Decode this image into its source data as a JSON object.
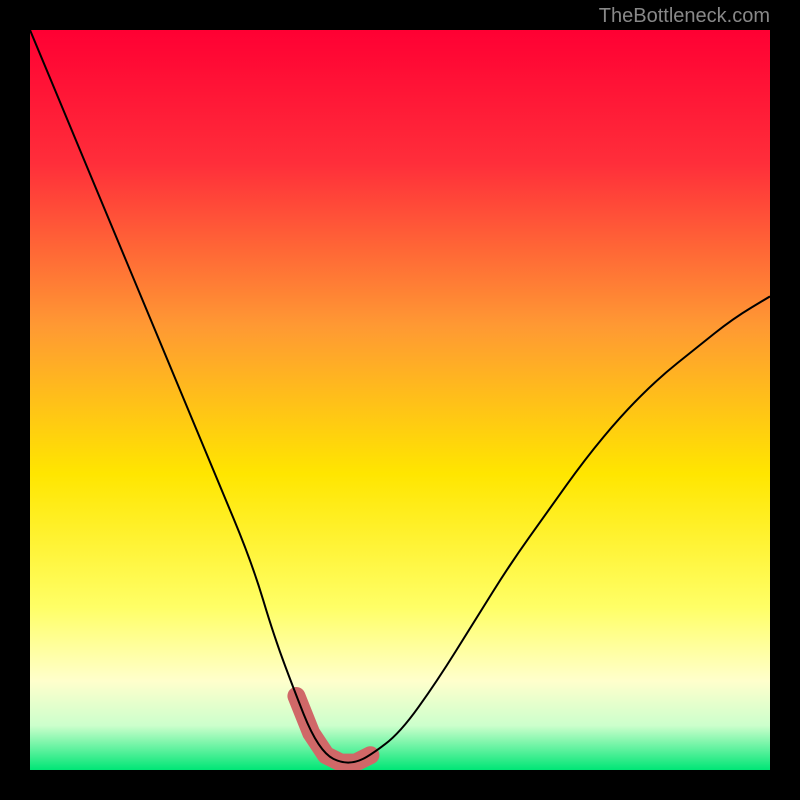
{
  "watermark": "TheBottleneck.com",
  "chart_data": {
    "type": "line",
    "title": "",
    "xlabel": "",
    "ylabel": "",
    "xlim": [
      0,
      100
    ],
    "ylim": [
      0,
      100
    ],
    "series": [
      {
        "name": "bottleneck-curve",
        "x": [
          0,
          5,
          10,
          15,
          20,
          25,
          30,
          33,
          36,
          38,
          40,
          42,
          44,
          46,
          50,
          55,
          60,
          65,
          70,
          75,
          80,
          85,
          90,
          95,
          100
        ],
        "y": [
          100,
          88,
          76,
          64,
          52,
          40,
          28,
          18,
          10,
          5,
          2,
          1,
          1,
          2,
          5,
          12,
          20,
          28,
          35,
          42,
          48,
          53,
          57,
          61,
          64
        ]
      }
    ],
    "highlight_region": {
      "name": "optimal-zone",
      "x": [
        36,
        38,
        40,
        42,
        44,
        46
      ],
      "y": [
        10,
        5,
        2,
        1,
        1,
        2
      ]
    },
    "gradient_stops": [
      {
        "offset": 0,
        "color": "#ff0033"
      },
      {
        "offset": 0.18,
        "color": "#ff2e3a"
      },
      {
        "offset": 0.4,
        "color": "#ff9933"
      },
      {
        "offset": 0.6,
        "color": "#ffe600"
      },
      {
        "offset": 0.78,
        "color": "#ffff66"
      },
      {
        "offset": 0.88,
        "color": "#ffffcc"
      },
      {
        "offset": 0.94,
        "color": "#ccffcc"
      },
      {
        "offset": 1.0,
        "color": "#00e676"
      }
    ]
  }
}
